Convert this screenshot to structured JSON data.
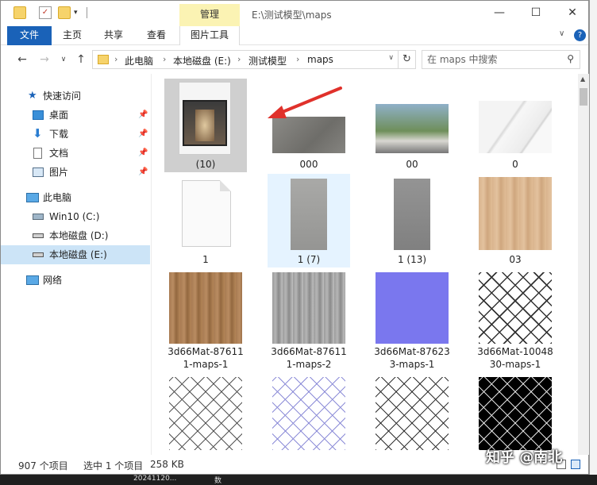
{
  "titlebar": {
    "manage_tab": "管理",
    "path_title": "E:\\测试模型\\maps"
  },
  "ribbon": {
    "file": "文件",
    "home": "主页",
    "share": "共享",
    "view": "查看",
    "picture_tools": "图片工具"
  },
  "address": {
    "crumbs": [
      "此电脑",
      "本地磁盘 (E:)",
      "测试模型",
      "maps"
    ],
    "search_placeholder": "在 maps 中搜索"
  },
  "nav": {
    "quick_access": "快速访问",
    "desktop": "桌面",
    "downloads": "下载",
    "documents": "文档",
    "pictures": "图片",
    "this_pc": "此电脑",
    "win10_c": "Win10 (C:)",
    "disk_d": "本地磁盘 (D:)",
    "disk_e": "本地磁盘 (E:)",
    "network": "网络"
  },
  "files": [
    {
      "name": "(10)",
      "thumb": "corridor-photo"
    },
    {
      "name": "000",
      "thumb": "grey-concrete"
    },
    {
      "name": "00",
      "thumb": "building-photo"
    },
    {
      "name": "0",
      "thumb": "white-marble"
    },
    {
      "name": "1",
      "thumb": "blank-document"
    },
    {
      "name": "1 (7)",
      "thumb": "grey-stone-tall"
    },
    {
      "name": "1 (13)",
      "thumb": "grey-stone-tall"
    },
    {
      "name": "03",
      "thumb": "light-wood"
    },
    {
      "name": "3d66Mat-87611\n1-maps-1",
      "thumb": "dark-wood"
    },
    {
      "name": "3d66Mat-87611\n1-maps-2",
      "thumb": "grey-wood"
    },
    {
      "name": "3d66Mat-87623\n3-maps-1",
      "thumb": "blue-normal-map"
    },
    {
      "name": "3d66Mat-10048\n30-maps-1",
      "thumb": "chain-link-white"
    },
    {
      "name": "",
      "thumb": "chain-link-white"
    },
    {
      "name": "",
      "thumb": "chain-link-blue"
    },
    {
      "name": "",
      "thumb": "chain-link-white"
    },
    {
      "name": "",
      "thumb": "chain-link-black"
    }
  ],
  "status": {
    "count": "907 个项目",
    "selected": "选中 1 个项目",
    "size": "258 KB"
  },
  "watermark": "知乎 @南北",
  "background_text": {
    "left": "20241120...",
    "right": "数"
  },
  "colors": {
    "accent": "#1a62b8",
    "manage_tab_bg": "#fbf3b3",
    "selection": "#cce4f7",
    "arrow": "#e0312b"
  }
}
